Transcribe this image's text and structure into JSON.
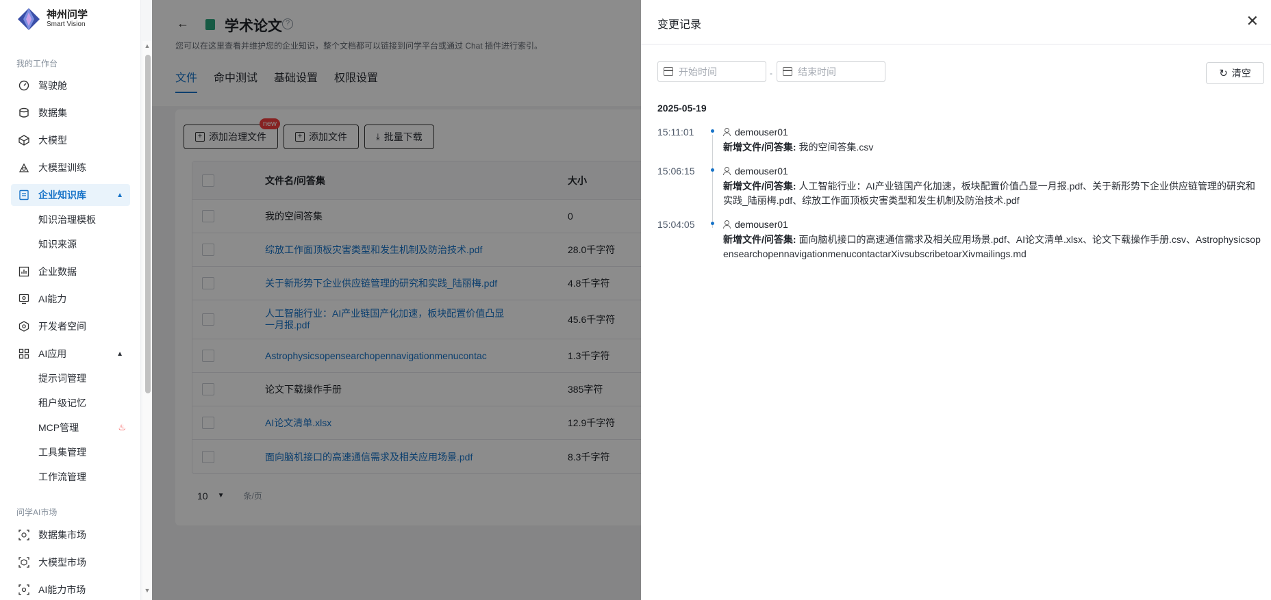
{
  "logo": {
    "main": "神州问学",
    "sub": "Smart Vision"
  },
  "sidebar": {
    "section1": "我的工作台",
    "items": [
      {
        "label": "驾驶舱",
        "icon": "dashboard-icon"
      },
      {
        "label": "数据集",
        "icon": "database-icon"
      },
      {
        "label": "大模型",
        "icon": "cube-icon"
      },
      {
        "label": "大模型训练",
        "icon": "training-icon"
      },
      {
        "label": "企业知识库",
        "icon": "knowledge-base-icon",
        "active": true
      },
      {
        "label": "企业数据",
        "icon": "chart-icon"
      },
      {
        "label": "AI能力",
        "icon": "ai-capability-icon"
      },
      {
        "label": "开发者空间",
        "icon": "developer-icon"
      },
      {
        "label": "AI应用",
        "icon": "apps-grid-icon"
      }
    ],
    "kb_sub": [
      "知识治理模板",
      "知识来源"
    ],
    "app_sub": [
      "提示词管理",
      "租户级记忆",
      "MCP管理",
      "工具集管理",
      "工作流管理"
    ],
    "section2": "问学AI市场",
    "market": [
      {
        "label": "数据集市场"
      },
      {
        "label": "大模型市场"
      },
      {
        "label": "AI能力市场"
      }
    ]
  },
  "header": {
    "title": "学术论文",
    "desc": "您可以在这里查看并维护您的企业知识，整个文档都可以链接到问学平台或通过 Chat 插件进行索引。",
    "tabs": [
      "文件",
      "命中测试",
      "基础设置",
      "权限设置"
    ]
  },
  "toolbar": {
    "add_governed": "添加治理文件",
    "new_badge": "new",
    "add_file": "添加文件",
    "bulk_download": "批量下载"
  },
  "table": {
    "col_name": "文件名/问答集",
    "col_size": "大小",
    "rows": [
      {
        "name": "我的空间答集",
        "size": "0",
        "link": false
      },
      {
        "name": "综放工作面顶板灾害类型和发生机制及防治技术.pdf",
        "size": "28.0千字符",
        "link": true
      },
      {
        "name": "关于新形势下企业供应链管理的研究和实践_陆丽梅.pdf",
        "size": "4.8千字符",
        "link": true
      },
      {
        "name": "人工智能行业：AI产业链国产化加速，板块配置价值凸显一月报.pdf",
        "size": "45.6千字符",
        "link": true
      },
      {
        "name": "Astrophysicsopensearchopennavigationmenucontac",
        "size": "1.3千字符",
        "link": true
      },
      {
        "name": "论文下载操作手册",
        "size": "385字符",
        "link": false
      },
      {
        "name": "AI论文清单.xlsx",
        "size": "12.9千字符",
        "link": true
      },
      {
        "name": "面向脑机接口的高速通信需求及相关应用场景.pdf",
        "size": "8.3千字符",
        "link": true
      }
    ]
  },
  "pager": {
    "size": "10",
    "unit": "条/页"
  },
  "drawer": {
    "title": "变更记录",
    "start_placeholder": "开始时间",
    "end_placeholder": "结束时间",
    "separator": "-",
    "clear": "清空",
    "date": "2025-05-19",
    "logs": [
      {
        "time": "15:11:01",
        "user": "demouser01",
        "action": "新增文件/问答集:",
        "detail": "我的空间答集.csv"
      },
      {
        "time": "15:06:15",
        "user": "demouser01",
        "action": "新增文件/问答集:",
        "detail": "人工智能行业：AI产业链国产化加速，板块配置价值凸显一月报.pdf、关于新形势下企业供应链管理的研究和实践_陆丽梅.pdf、综放工作面顶板灾害类型和发生机制及防治技术.pdf"
      },
      {
        "time": "15:04:05",
        "user": "demouser01",
        "action": "新增文件/问答集:",
        "detail": "面向脑机接口的高速通信需求及相关应用场景.pdf、AI论文清单.xlsx、论文下载操作手册.csv、AstrophysicsopensearchopennavigationmenucontactarXivsubscribetoarXivmailings.md"
      }
    ]
  }
}
